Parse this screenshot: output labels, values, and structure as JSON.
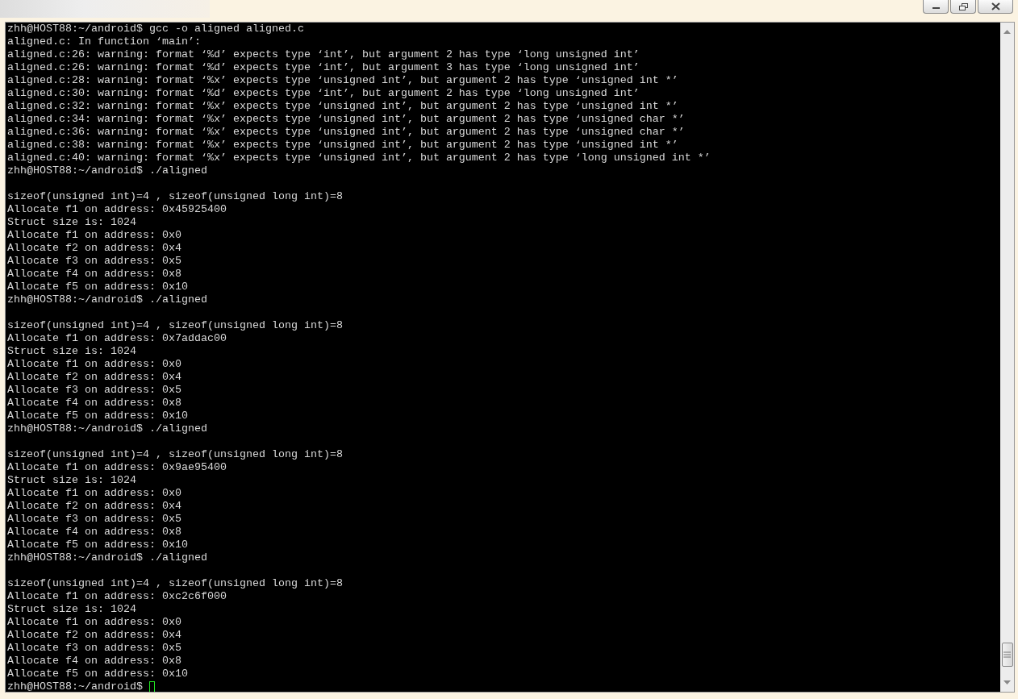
{
  "terminal": {
    "blocks": [
      [
        "zhh@HOST88:~/android$ gcc -o aligned aligned.c",
        "aligned.c: In function ‘main’:",
        "aligned.c:26: warning: format ‘%d’ expects type ‘int’, but argument 2 has type ‘long unsigned int’",
        "aligned.c:26: warning: format ‘%d’ expects type ‘int’, but argument 3 has type ‘long unsigned int’",
        "aligned.c:28: warning: format ‘%x’ expects type ‘unsigned int’, but argument 2 has type ‘unsigned int *’",
        "aligned.c:30: warning: format ‘%d’ expects type ‘int’, but argument 2 has type ‘long unsigned int’",
        "aligned.c:32: warning: format ‘%x’ expects type ‘unsigned int’, but argument 2 has type ‘unsigned int *’",
        "aligned.c:34: warning: format ‘%x’ expects type ‘unsigned int’, but argument 2 has type ‘unsigned char *’",
        "aligned.c:36: warning: format ‘%x’ expects type ‘unsigned int’, but argument 2 has type ‘unsigned char *’",
        "aligned.c:38: warning: format ‘%x’ expects type ‘unsigned int’, but argument 2 has type ‘unsigned int *’",
        "aligned.c:40: warning: format ‘%x’ expects type ‘unsigned int’, but argument 2 has type ‘long unsigned int *’",
        "zhh@HOST88:~/android$ ./aligned"
      ],
      [
        "sizeof(unsigned int)=4 , sizeof(unsigned long int)=8",
        "Allocate f1 on address: 0x45925400",
        "Struct size is: 1024",
        "Allocate f1 on address: 0x0",
        "Allocate f2 on address: 0x4",
        "Allocate f3 on address: 0x5",
        "Allocate f4 on address: 0x8",
        "Allocate f5 on address: 0x10",
        "zhh@HOST88:~/android$ ./aligned"
      ],
      [
        "sizeof(unsigned int)=4 , sizeof(unsigned long int)=8",
        "Allocate f1 on address: 0x7addac00",
        "Struct size is: 1024",
        "Allocate f1 on address: 0x0",
        "Allocate f2 on address: 0x4",
        "Allocate f3 on address: 0x5",
        "Allocate f4 on address: 0x8",
        "Allocate f5 on address: 0x10",
        "zhh@HOST88:~/android$ ./aligned"
      ],
      [
        "sizeof(unsigned int)=4 , sizeof(unsigned long int)=8",
        "Allocate f1 on address: 0x9ae95400",
        "Struct size is: 1024",
        "Allocate f1 on address: 0x0",
        "Allocate f2 on address: 0x4",
        "Allocate f3 on address: 0x5",
        "Allocate f4 on address: 0x8",
        "Allocate f5 on address: 0x10",
        "zhh@HOST88:~/android$ ./aligned"
      ],
      [
        "sizeof(unsigned int)=4 , sizeof(unsigned long int)=8",
        "Allocate f1 on address: 0xc2c6f000",
        "Struct size is: 1024",
        "Allocate f1 on address: 0x0",
        "Allocate f2 on address: 0x4",
        "Allocate f3 on address: 0x5",
        "Allocate f4 on address: 0x8",
        "Allocate f5 on address: 0x10",
        "zhh@HOST88:~/android$"
      ]
    ],
    "cursor_visible": true
  }
}
